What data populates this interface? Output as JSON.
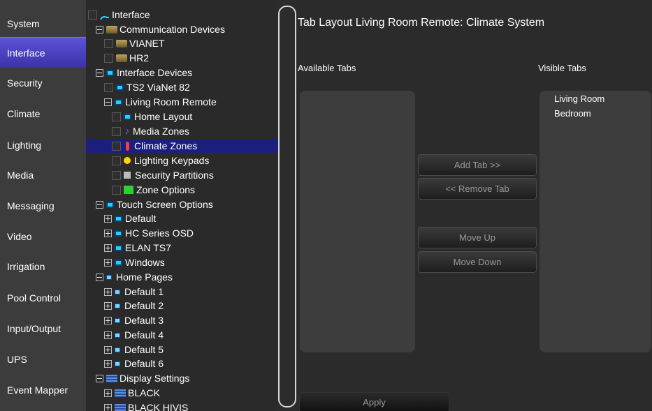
{
  "nav": {
    "items": [
      {
        "label": "System"
      },
      {
        "label": "Interface"
      },
      {
        "label": "Security"
      },
      {
        "label": "Climate"
      },
      {
        "label": "Lighting"
      },
      {
        "label": "Media"
      },
      {
        "label": "Messaging"
      },
      {
        "label": "Video"
      },
      {
        "label": "Irrigation"
      },
      {
        "label": "Pool Control"
      },
      {
        "label": "Input/Output"
      },
      {
        "label": "UPS"
      },
      {
        "label": "Event Mapper"
      }
    ],
    "active": "Interface"
  },
  "tree": {
    "root": "Interface",
    "communication_devices": "Communication Devices",
    "vianet": "VIANET",
    "hr2": "HR2",
    "interface_devices": "Interface Devices",
    "ts2": "TS2 ViaNet 82",
    "living_room_remote": "Living Room Remote",
    "home_layout": "Home Layout",
    "media_zones": "Media Zones",
    "climate_zones": "Climate Zones",
    "lighting_keypads": "Lighting Keypads",
    "security_partitions": "Security Partitions",
    "zone_options": "Zone Options",
    "touch_screen_options": "Touch Screen Options",
    "default": "Default",
    "hc_series_osd": "HC Series OSD",
    "elan_ts7": "ELAN TS7",
    "windows": "Windows",
    "home_pages": "Home Pages",
    "default_1": "Default 1",
    "default_2": "Default 2",
    "default_3": "Default 3",
    "default_4": "Default 4",
    "default_5": "Default 5",
    "default_6": "Default 6",
    "display_settings": "Display Settings",
    "black": "BLACK",
    "black_hivis": "BLACK HIVIS",
    "selected": "Climate Zones"
  },
  "main": {
    "title": "Tab Layout Living Room Remote: Climate System",
    "available_label": "Available Tabs",
    "visible_label": "Visible Tabs",
    "available_tabs": [],
    "visible_tabs": [
      "Living Room",
      "Bedroom"
    ],
    "buttons": {
      "add_tab": "Add Tab >>",
      "remove_tab": "<< Remove Tab",
      "move_up": "Move Up",
      "move_down": "Move Down",
      "apply": "Apply"
    }
  },
  "colors": {
    "nav_active": "#4a42c4",
    "tree_selected": "#1d1f7e",
    "background": "#2c2c2c",
    "panel": "#3d3d3d"
  }
}
